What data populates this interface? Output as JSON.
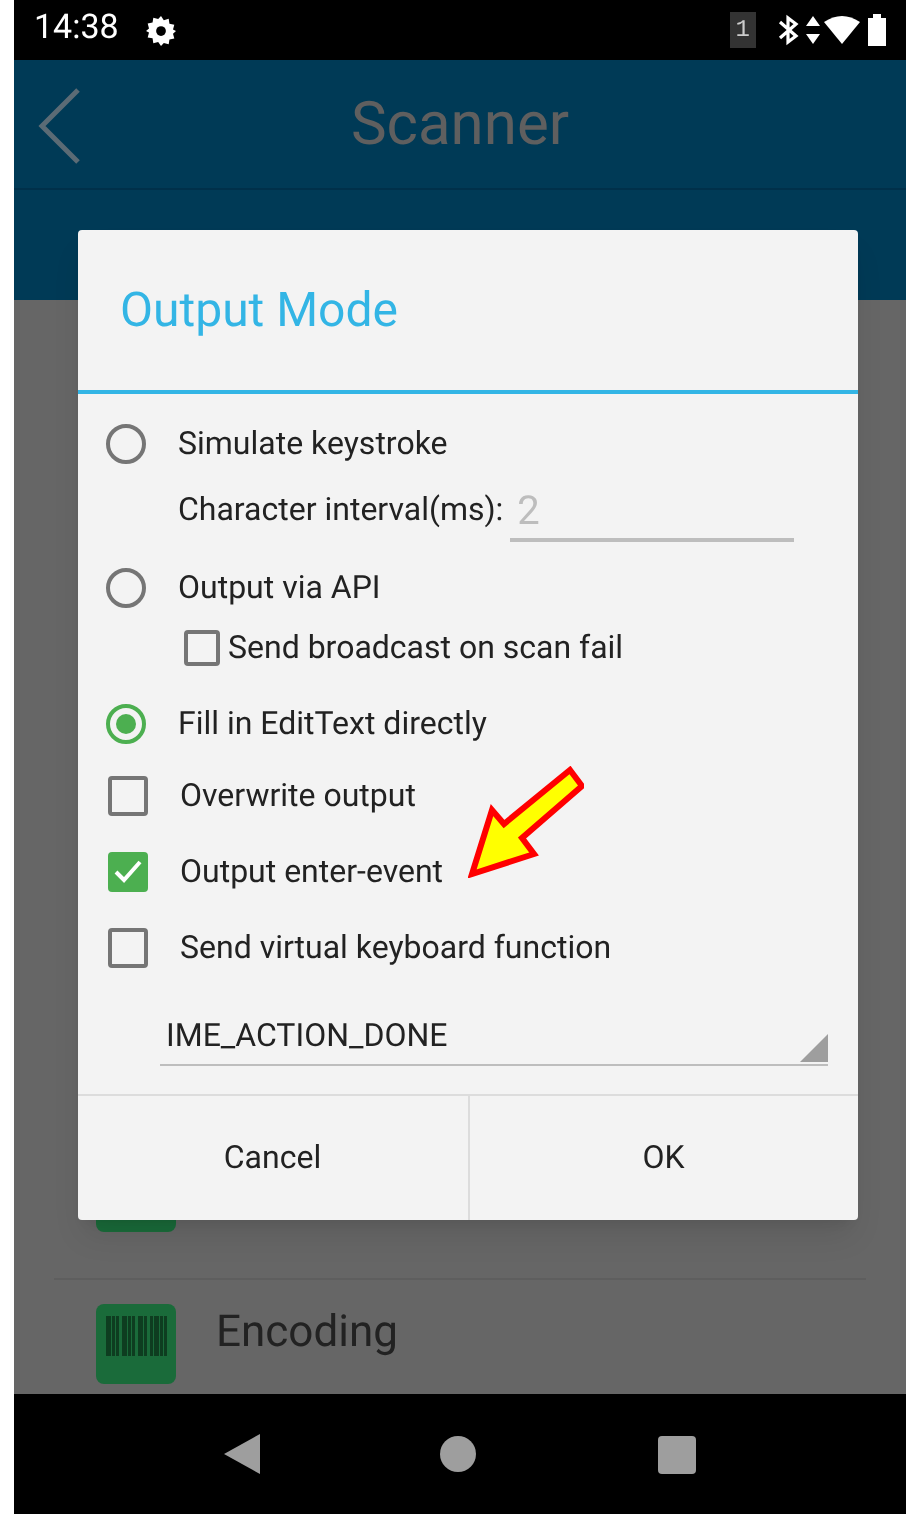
{
  "status_bar": {
    "time": "14:38",
    "sim_badge": "1"
  },
  "app_bar": {
    "title": "Scanner"
  },
  "background_list": [
    {
      "title": "Encoding"
    }
  ],
  "dialog": {
    "title": "Output Mode",
    "options": [
      {
        "kind": "radio",
        "label": "Simulate keystroke",
        "selected": false
      },
      {
        "kind": "field",
        "label": "Character interval(ms):",
        "placeholder": "2"
      },
      {
        "kind": "radio",
        "label": "Output via API",
        "selected": false
      },
      {
        "kind": "subcheck",
        "label": "Send broadcast on scan fail",
        "checked": false
      },
      {
        "kind": "radio",
        "label": "Fill in EditText directly",
        "selected": true
      },
      {
        "kind": "checkbox",
        "label": "Overwrite output",
        "checked": false
      },
      {
        "kind": "checkbox",
        "label": "Output enter-event",
        "checked": true
      },
      {
        "kind": "checkbox",
        "label": "Send virtual keyboard function",
        "checked": false
      },
      {
        "kind": "spinner",
        "value": "IME_ACTION_DONE"
      }
    ],
    "buttons": [
      "Cancel",
      "OK"
    ]
  }
}
